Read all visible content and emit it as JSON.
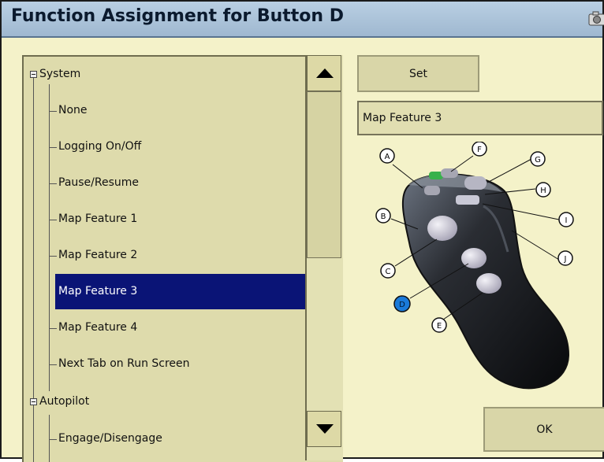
{
  "window": {
    "title": "Function Assignment for Button D"
  },
  "tree": {
    "groups": [
      {
        "label": "System"
      },
      {
        "label": "Autopilot"
      }
    ],
    "items": [
      {
        "label": "None"
      },
      {
        "label": "Logging On/Off"
      },
      {
        "label": "Pause/Resume"
      },
      {
        "label": "Map Feature 1"
      },
      {
        "label": "Map Feature 2"
      },
      {
        "label": "Map Feature 3",
        "selected": true
      },
      {
        "label": "Map Feature 4"
      },
      {
        "label": "Next Tab on Run Screen"
      },
      {
        "label": "Engage/Disengage"
      }
    ]
  },
  "buttons": {
    "set_label": "Set",
    "ok_label": "OK"
  },
  "selection": {
    "value": "Map Feature 3"
  },
  "joystick": {
    "labels": [
      "A",
      "B",
      "C",
      "D",
      "E",
      "F",
      "G",
      "H",
      "I",
      "J"
    ]
  },
  "colors": {
    "accent": "#0a1476",
    "background": "#f4f2c9",
    "selected_button_marker": "#1a7ad9"
  }
}
